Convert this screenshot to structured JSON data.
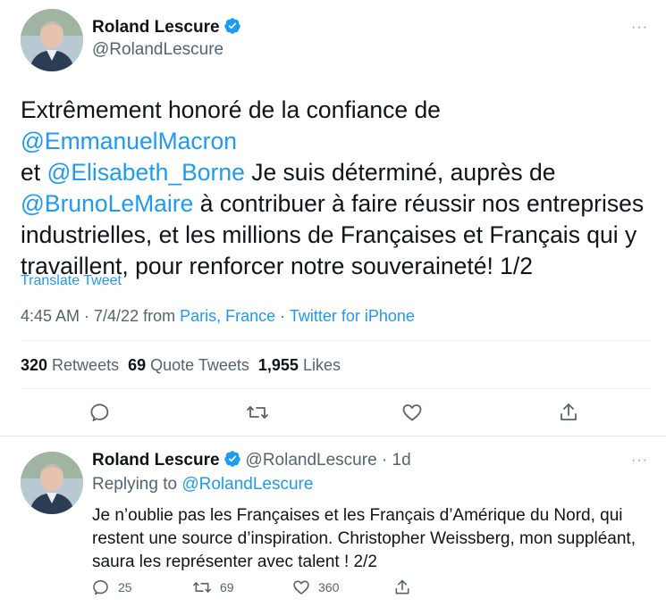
{
  "main_tweet": {
    "author_name": "Roland Lescure",
    "author_handle": "@RolandLescure",
    "text_parts": [
      "Extrêmement honoré de la confiance de ",
      "@EmmanuelMacron",
      " et ",
      "@Elisabeth_Borne",
      " Je suis déterminé, auprès de ",
      "@BrunoLeMaire",
      " à contribuer à faire réussir nos entreprises industrielles, et les millions de Françaises et Français qui y travaillent, pour renforcer notre souveraineté! 1/2"
    ],
    "translate_label": "Translate Tweet",
    "time": "4:45 AM · 7/4/22 from ",
    "location": "Paris, France",
    "separator": " · ",
    "source": "Twitter for iPhone",
    "retweets_count": "320",
    "retweets_label": " Retweets",
    "quotes_count": "69",
    "quotes_label": " Quote Tweets",
    "likes_count": "1,955",
    "likes_label": " Likes"
  },
  "reply_tweet": {
    "author_name": "Roland Lescure",
    "author_handle": "@RolandLescure",
    "age": " · 1d",
    "replying_label": "Replying to ",
    "replying_handle": "@RolandLescure",
    "text": "Je n’oublie pas les Françaises et les Français d’Amérique du Nord, qui restent une source d’inspiration. Christopher Weissberg, mon suppléant, saura les représenter avec talent ! 2/2",
    "reply_count": "25",
    "retweet_count": "69",
    "like_count": "360"
  },
  "more_glyph": "···",
  "colors": {
    "accent": "#1d9bf0",
    "text": "#0f1419",
    "muted": "#536471",
    "divider": "#eff3f4"
  },
  "icons": [
    "verified-badge-icon",
    "reply-icon",
    "retweet-icon",
    "like-icon",
    "share-icon",
    "more-icon"
  ]
}
